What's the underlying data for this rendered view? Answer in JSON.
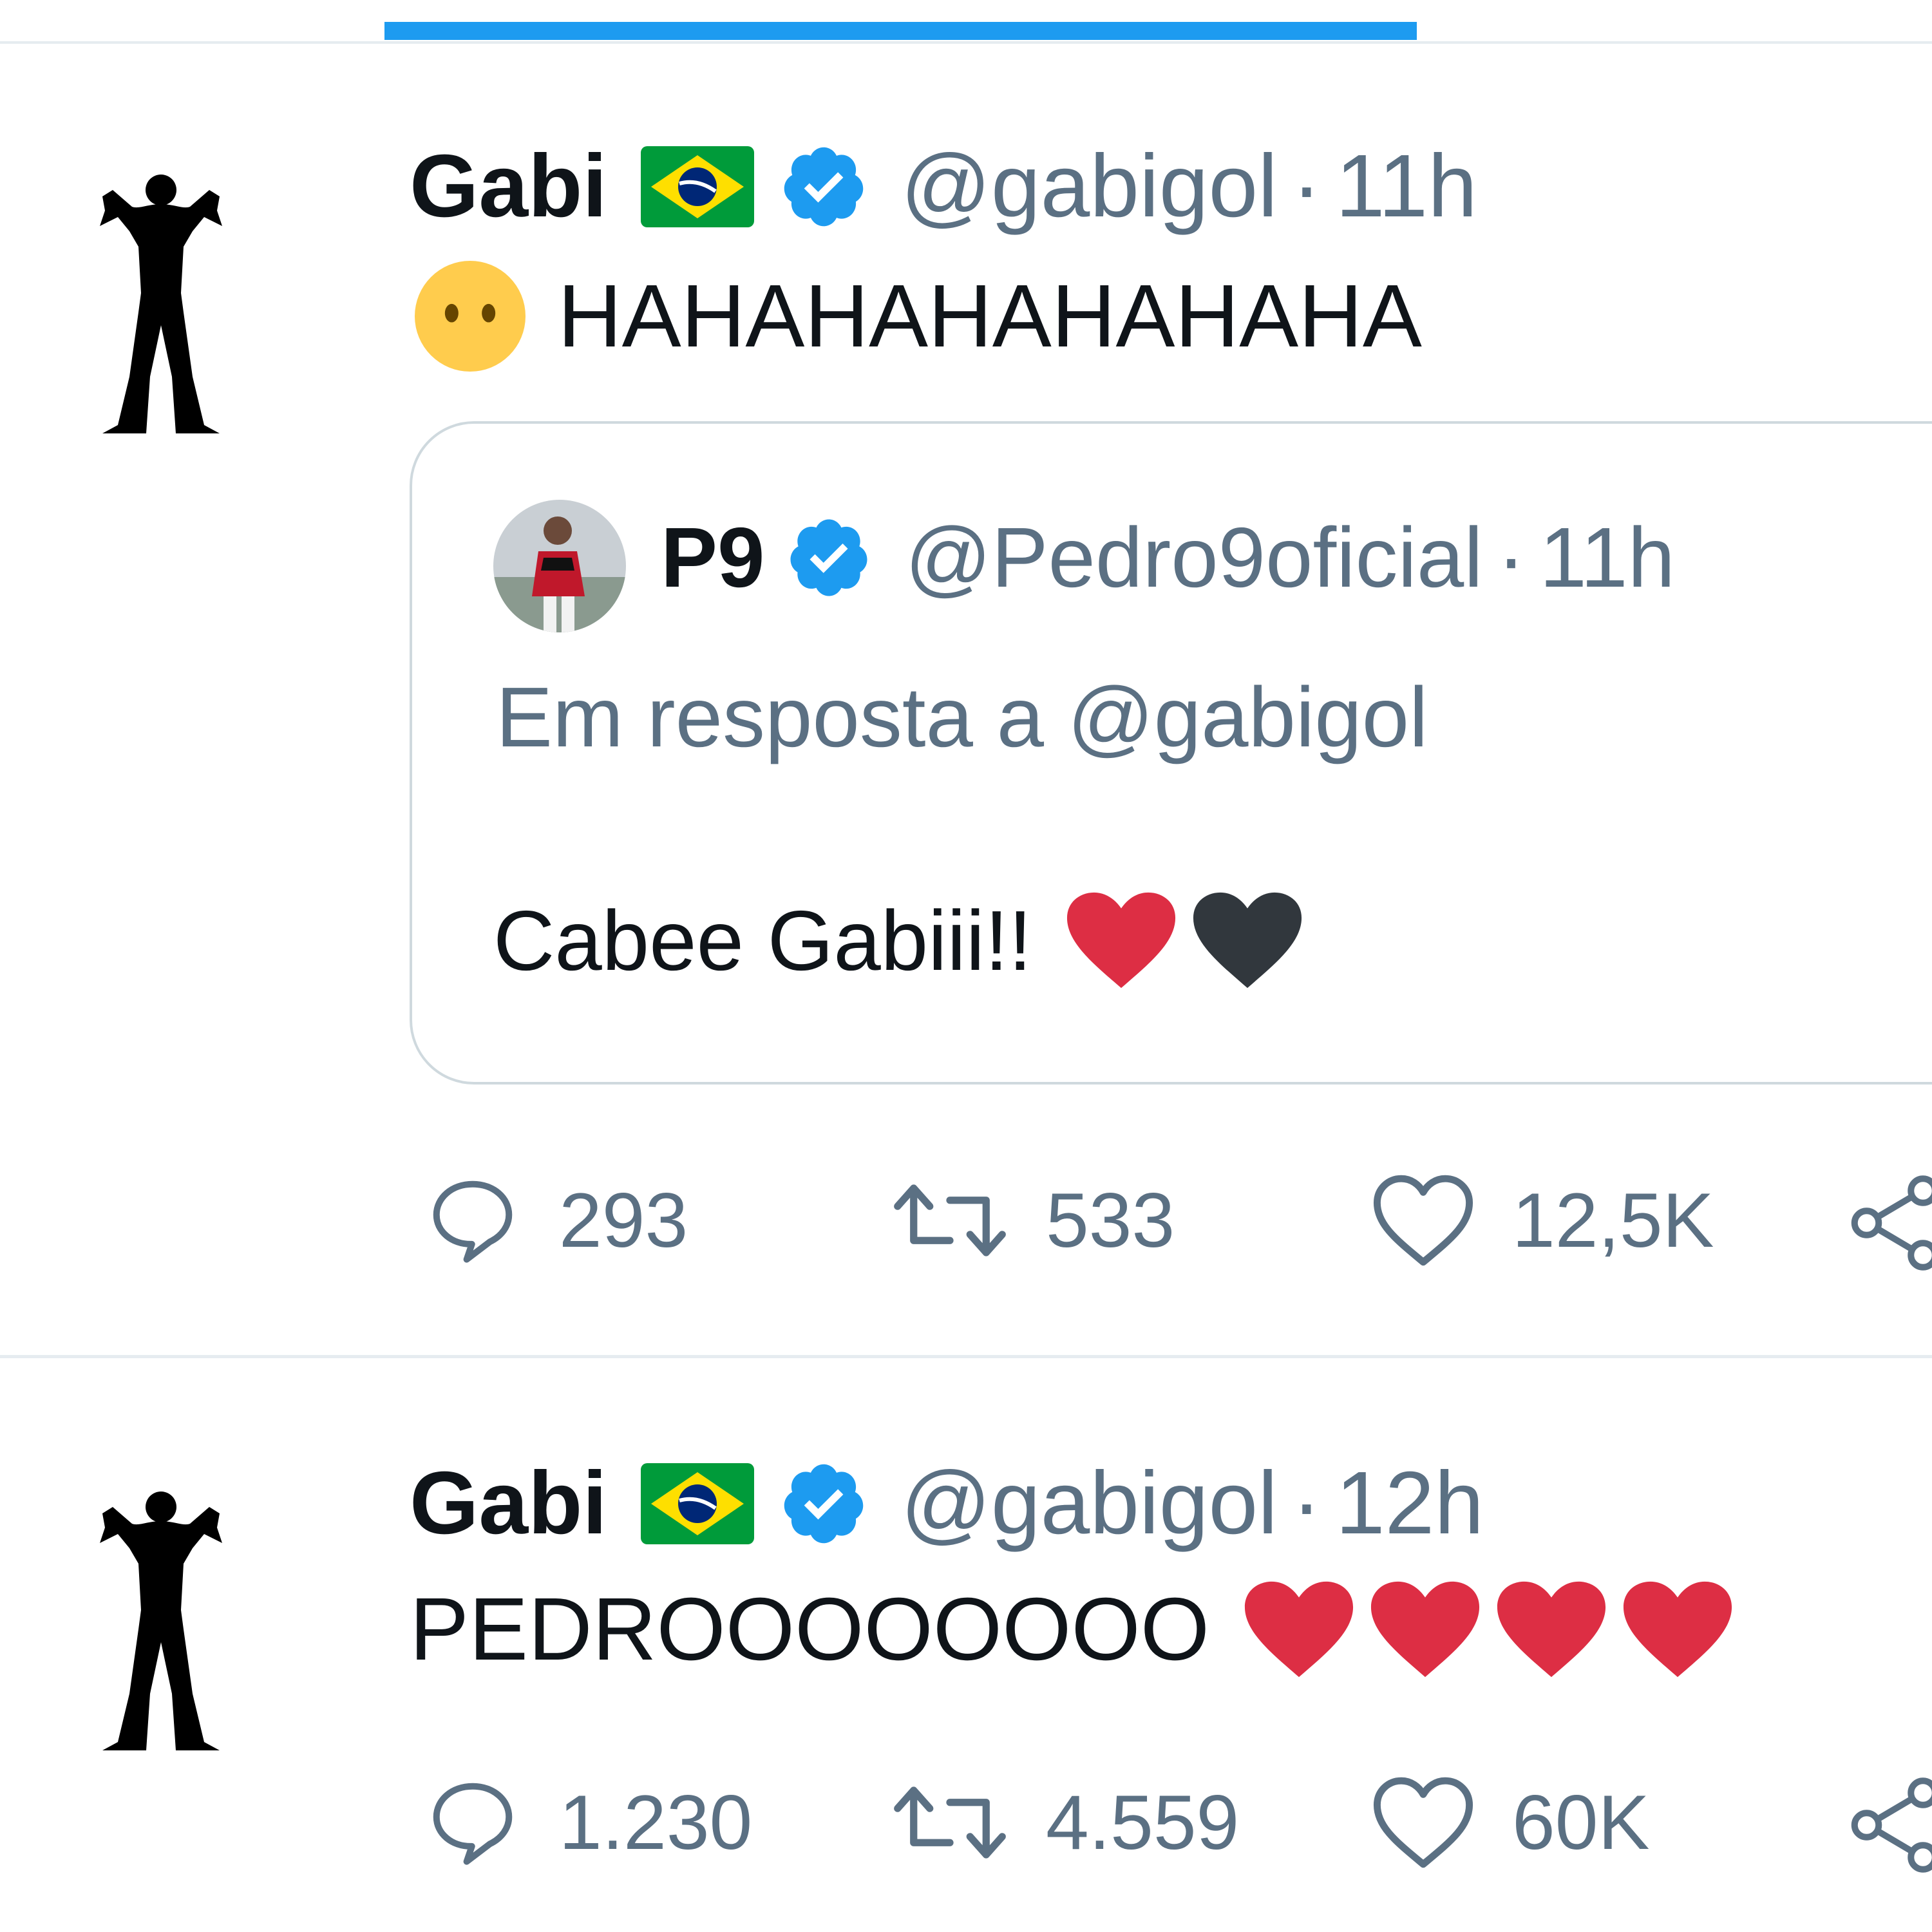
{
  "tweets": [
    {
      "author_name": "Gabi",
      "author_flag_icon": "brazil-flag-icon",
      "author_handle": "@gabigol",
      "separator": "·",
      "time": "11h",
      "emoji_icon": "face-without-mouth-icon",
      "text": "HAHAHAHAHAHAHA",
      "quote": {
        "author_name": "P9",
        "author_handle": "@Pedro9oficial",
        "separator": "·",
        "time": "11h",
        "reply_to": "Em resposta a @gabigol",
        "text": "Cabee Gabiii!!",
        "emoji_icons": [
          "red-heart-icon",
          "black-heart-icon"
        ]
      },
      "counts": {
        "replies": "293",
        "retweets": "533",
        "likes": "12,5K"
      }
    },
    {
      "author_name": "Gabi",
      "author_flag_icon": "brazil-flag-icon",
      "author_handle": "@gabigol",
      "separator": "·",
      "time": "12h",
      "text": "PEDROOOOOOOO",
      "emoji_icons": [
        "red-heart-icon",
        "red-heart-icon",
        "red-heart-icon",
        "red-heart-icon"
      ],
      "counts": {
        "replies": "1.230",
        "retweets": "4.559",
        "likes": "60K"
      }
    }
  ],
  "colors": {
    "accent": "#1d9bf0",
    "verified": "#1d9bf0",
    "secondary_text": "#5b7083",
    "divider": "#e6ecf0",
    "heart_red": "#dd2e44",
    "heart_black": "#31373d"
  }
}
